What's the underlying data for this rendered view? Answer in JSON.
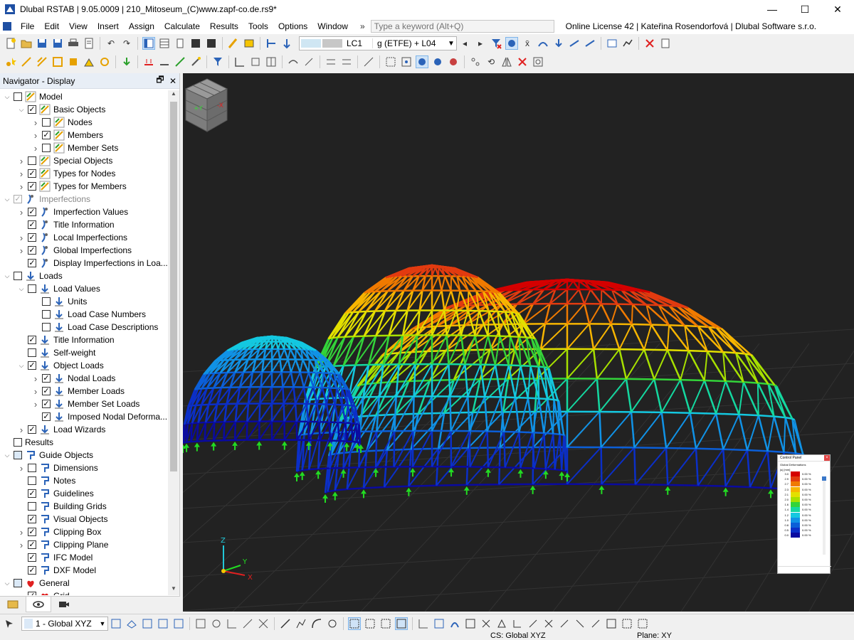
{
  "window": {
    "title": "Dlubal RSTAB | 9.05.0009 | 210_Mitoseum_(C)www.zapf-co.de.rs9*",
    "controls": [
      "minimize",
      "maximize",
      "close"
    ]
  },
  "menubar": {
    "items": [
      "File",
      "Edit",
      "View",
      "Insert",
      "Assign",
      "Calculate",
      "Results",
      "Tools",
      "Options",
      "Window"
    ],
    "overflow": "»",
    "search_placeholder": "Type a keyword (Alt+Q)",
    "license": "Online License 42 | Kateřina Rosendorfová | Dlubal Software s.r.o."
  },
  "toolbar": {
    "load_case_code": "LC1",
    "load_case_name": "g (ETFE) + L04",
    "prev_arrow": "◂",
    "next_arrow": "▸"
  },
  "navigator": {
    "title": "Navigator - Display",
    "items": [
      {
        "label": "Model",
        "level": 0,
        "expanded": true,
        "checked": false,
        "icon": "model-icon"
      },
      {
        "label": "Basic Objects",
        "level": 1,
        "expanded": true,
        "checked": true,
        "icon": "model-icon"
      },
      {
        "label": "Nodes",
        "level": 2,
        "expanded": false,
        "checked": false,
        "icon": "model-icon"
      },
      {
        "label": "Members",
        "level": 2,
        "expanded": false,
        "checked": true,
        "icon": "model-icon"
      },
      {
        "label": "Member Sets",
        "level": 2,
        "expanded": false,
        "checked": false,
        "icon": "model-icon"
      },
      {
        "label": "Special Objects",
        "level": 1,
        "expanded": false,
        "checked": false,
        "icon": "model-icon"
      },
      {
        "label": "Types for Nodes",
        "level": 1,
        "expanded": false,
        "checked": true,
        "icon": "model-icon"
      },
      {
        "label": "Types for Members",
        "level": 1,
        "expanded": false,
        "checked": true,
        "icon": "model-icon"
      },
      {
        "label": "Imperfections",
        "level": 0,
        "expanded": true,
        "checked": true,
        "dim": true,
        "icon": "imperfection-icon"
      },
      {
        "label": "Imperfection Values",
        "level": 1,
        "expanded": false,
        "checked": true,
        "icon": "imperfection-icon"
      },
      {
        "label": "Title Information",
        "level": 1,
        "checked": true,
        "icon": "imperfection-icon"
      },
      {
        "label": "Local Imperfections",
        "level": 1,
        "expanded": false,
        "checked": true,
        "icon": "imperfection-icon"
      },
      {
        "label": "Global Imperfections",
        "level": 1,
        "expanded": false,
        "checked": true,
        "icon": "imperfection-icon"
      },
      {
        "label": "Display Imperfections in Loa...",
        "level": 1,
        "checked": true,
        "icon": "imperfection-icon"
      },
      {
        "label": "Loads",
        "level": 0,
        "expanded": true,
        "checked": false,
        "icon": "load-icon"
      },
      {
        "label": "Load Values",
        "level": 1,
        "expanded": true,
        "checked": false,
        "icon": "load-icon"
      },
      {
        "label": "Units",
        "level": 2,
        "checked": false,
        "icon": "load-icon"
      },
      {
        "label": "Load Case Numbers",
        "level": 2,
        "checked": false,
        "icon": "load-icon"
      },
      {
        "label": "Load Case Descriptions",
        "level": 2,
        "checked": false,
        "icon": "load-icon"
      },
      {
        "label": "Title Information",
        "level": 1,
        "checked": true,
        "icon": "load-icon"
      },
      {
        "label": "Self-weight",
        "level": 1,
        "checked": false,
        "icon": "load-icon"
      },
      {
        "label": "Object Loads",
        "level": 1,
        "expanded": true,
        "checked": true,
        "icon": "load-icon"
      },
      {
        "label": "Nodal Loads",
        "level": 2,
        "expanded": false,
        "checked": true,
        "icon": "load-icon"
      },
      {
        "label": "Member Loads",
        "level": 2,
        "expanded": false,
        "checked": true,
        "icon": "load-icon"
      },
      {
        "label": "Member Set Loads",
        "level": 2,
        "expanded": false,
        "checked": true,
        "icon": "load-icon"
      },
      {
        "label": "Imposed Nodal Deforma...",
        "level": 2,
        "checked": true,
        "icon": "load-icon"
      },
      {
        "label": "Load Wizards",
        "level": 1,
        "expanded": false,
        "checked": true,
        "icon": "load-icon"
      },
      {
        "label": "Results",
        "level": 0,
        "checked": false,
        "icon": "none"
      },
      {
        "label": "Guide Objects",
        "level": 0,
        "expanded": true,
        "checked": false,
        "partial": true,
        "icon": "guide-icon"
      },
      {
        "label": "Dimensions",
        "level": 1,
        "expanded": false,
        "checked": false,
        "icon": "guide-icon"
      },
      {
        "label": "Notes",
        "level": 1,
        "checked": false,
        "icon": "guide-icon"
      },
      {
        "label": "Guidelines",
        "level": 1,
        "checked": true,
        "icon": "guide-icon"
      },
      {
        "label": "Building Grids",
        "level": 1,
        "checked": false,
        "icon": "guide-icon"
      },
      {
        "label": "Visual Objects",
        "level": 1,
        "checked": true,
        "icon": "guide-icon"
      },
      {
        "label": "Clipping Box",
        "level": 1,
        "expanded": false,
        "checked": true,
        "icon": "guide-icon"
      },
      {
        "label": "Clipping Plane",
        "level": 1,
        "expanded": false,
        "checked": true,
        "icon": "guide-icon"
      },
      {
        "label": "IFC Model",
        "level": 1,
        "checked": true,
        "icon": "guide-icon"
      },
      {
        "label": "DXF Model",
        "level": 1,
        "checked": true,
        "icon": "guide-icon"
      },
      {
        "label": "General",
        "level": 0,
        "expanded": true,
        "checked": false,
        "partial": true,
        "icon": "general-icon"
      },
      {
        "label": "Grid",
        "level": 1,
        "checked": true,
        "icon": "general-icon"
      }
    ]
  },
  "control_panel": {
    "title": "Control Panel",
    "subtitle_line1": "Global Deformations",
    "subtitle_line2": "|u| [mm]",
    "scale": [
      {
        "value": "3.0",
        "color": "#d50000",
        "percent": "0.00 %"
      },
      {
        "value": "2.9",
        "color": "#e23b10",
        "percent": "0.00 %"
      },
      {
        "value": "2.7",
        "color": "#f07a00",
        "percent": "0.00 %"
      },
      {
        "value": "2.3",
        "color": "#f7b500",
        "percent": "0.00 %"
      },
      {
        "value": "2.1",
        "color": "#e3e000",
        "percent": "0.00 %"
      },
      {
        "value": "2.0",
        "color": "#a7e000",
        "percent": "0.00 %"
      },
      {
        "value": "1.6",
        "color": "#33d43a",
        "percent": "0.00 %"
      },
      {
        "value": "1.4",
        "color": "#14d8a0",
        "percent": "0.00 %"
      },
      {
        "value": "1.2",
        "color": "#14c8e0",
        "percent": "0.00 %"
      },
      {
        "value": "1.0",
        "color": "#1092e6",
        "percent": "0.00 %"
      },
      {
        "value": "0.8",
        "color": "#0b5fd8",
        "percent": "0.00 %"
      },
      {
        "value": "0.5",
        "color": "#0b2fc8",
        "percent": "0.00 %"
      },
      {
        "value": "0.0",
        "color": "#0a0aa0",
        "percent": "0.00 %"
      }
    ]
  },
  "viewport": {
    "axis_labels": {
      "z": "Z",
      "y": "Y",
      "x": "X"
    },
    "viewcube": {
      "left_label": "+Y",
      "right_label": "-X"
    }
  },
  "bottombar": {
    "coordinate_system": "1 - Global XYZ"
  },
  "statusbar": {
    "cs": "CS: Global XYZ",
    "plane": "Plane: XY"
  }
}
